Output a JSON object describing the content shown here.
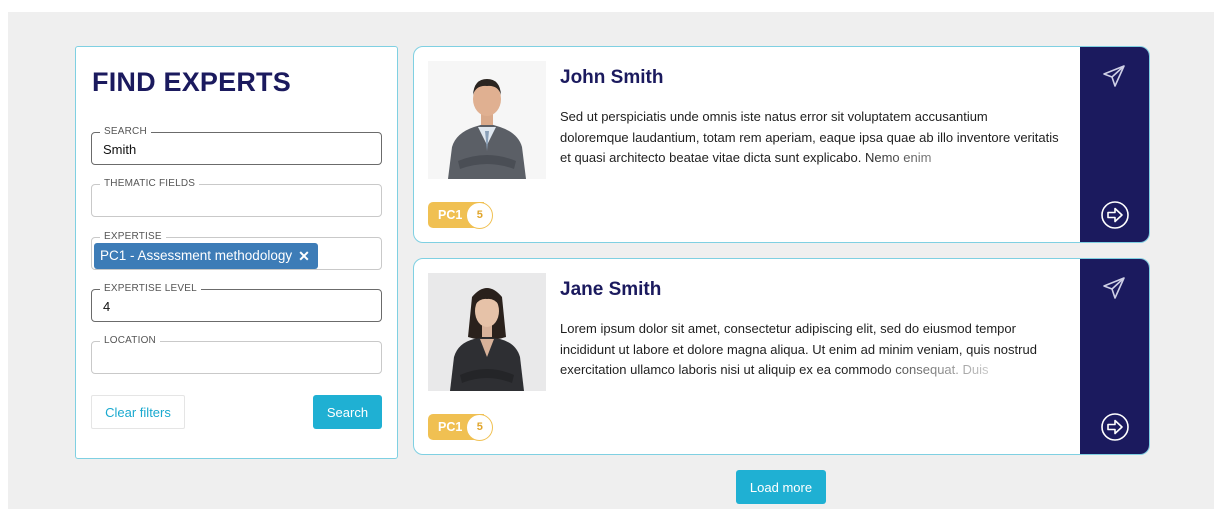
{
  "filter": {
    "title": "FIND EXPERTS",
    "fields": [
      {
        "label": "SEARCH",
        "value": "Smith"
      },
      {
        "label": "THEMATIC FIELDS",
        "value": ""
      },
      {
        "label": "EXPERTISE",
        "chip": "PC1 - Assessment methodology",
        "chip_close": "✕"
      },
      {
        "label": "EXPERTISE LEVEL",
        "value": "4"
      },
      {
        "label": "LOCATION",
        "value": ""
      }
    ],
    "clear_label": "Clear filters",
    "search_label": "Search"
  },
  "experts": [
    {
      "name": "John Smith",
      "bio": "Sed ut perspiciatis unde omnis iste natus error sit voluptatem accusantium doloremque laudantium, totam rem aperiam, eaque ipsa quae ab illo inventore veritatis et quasi architecto beatae vitae dicta sunt explicabo. Nemo enim",
      "badge_code": "PC1",
      "badge_count": "5"
    },
    {
      "name": "Jane Smith",
      "bio": "Lorem ipsum dolor sit amet, consectetur adipiscing elit, sed do eiusmod tempor incididunt ut labore et dolore magna aliqua. Ut enim ad minim veniam, quis nostrud exercitation ullamco laboris nisi ut aliquip ex ea commodo consequat. Duis",
      "badge_code": "PC1",
      "badge_count": "5"
    }
  ],
  "load_more_label": "Load more",
  "icons": {
    "send": "paper-plane-icon",
    "open": "circle-arrow-right-icon"
  },
  "colors": {
    "navy": "#1b1a5e",
    "accent": "#1fb0d3",
    "chip": "#3d7cb7",
    "badge": "#f0c052",
    "border": "#7fd0e2"
  }
}
